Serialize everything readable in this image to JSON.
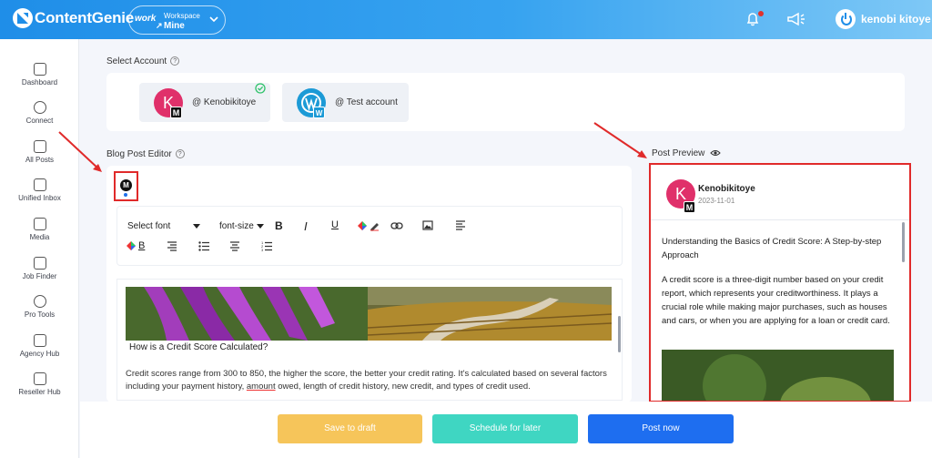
{
  "topbar": {
    "brand": "ContentGenie",
    "workspace": {
      "brand": "work",
      "brand_mark": "↗",
      "label": "Workspace",
      "value": "Mine"
    },
    "user_name": "kenobi kitoye"
  },
  "sidebar": {
    "items": [
      {
        "label": "Dashboard",
        "icon": "dashboard-icon"
      },
      {
        "label": "Connect",
        "icon": "broadcast-icon"
      },
      {
        "label": "All Posts",
        "icon": "bag-icon"
      },
      {
        "label": "Unified Inbox",
        "icon": "chat-icon"
      },
      {
        "label": "Media",
        "icon": "media-icon"
      },
      {
        "label": "Job Finder",
        "icon": "search-doc-icon"
      },
      {
        "label": "Pro Tools",
        "icon": "trophy-icon"
      },
      {
        "label": "Agency Hub",
        "icon": "shield-check-icon"
      },
      {
        "label": "Reseller Hub",
        "icon": "camera-icon"
      }
    ]
  },
  "select_account": {
    "label": "Select Account",
    "accounts": [
      {
        "initial": "K",
        "name": "@ Kenobikitoye",
        "badge": "M",
        "selected": true
      },
      {
        "initial": "W",
        "name": "@ Test account",
        "badge": "W",
        "selected": false
      }
    ]
  },
  "editor": {
    "label": "Blog Post Editor",
    "platform_badge": "M",
    "toolbar": {
      "font_select": "Select font",
      "size_select": "font-size",
      "bold": "B",
      "italic": "I",
      "underline": "U",
      "highlight_b": "B"
    },
    "content": {
      "heading": "How is a Credit Score Calculated?",
      "paragraph_before": "Credit scores range from 300 to 850, the higher the score, the better your credit rating. It's calculated based on several factors including your payment history,",
      "paragraph_underlined": "amount",
      "paragraph_after": "owed, length of credit history, new credit, and types of credit used."
    }
  },
  "preview": {
    "label": "Post Preview",
    "author_initial": "K",
    "author": "Kenobikitoye",
    "author_badge": "M",
    "date": "2023-11-01",
    "title": "Understanding the Basics of Credit Score: A Step-by-step Approach",
    "body": "A credit score is a three-digit number based on your credit report, which represents your creditworthiness. It plays a crucial role while making major purchases, such as houses and cars, or when you are applying for a loan or credit card."
  },
  "actions": {
    "draft": "Save to draft",
    "schedule": "Schedule for later",
    "post": "Post now"
  },
  "colors": {
    "brand_blue": "#1f8ee8",
    "draft": "#f6c55a",
    "schedule": "#3fd6c2",
    "post": "#1e6ef0",
    "avatar": "#e0306a",
    "highlight": "#e02a2a"
  }
}
